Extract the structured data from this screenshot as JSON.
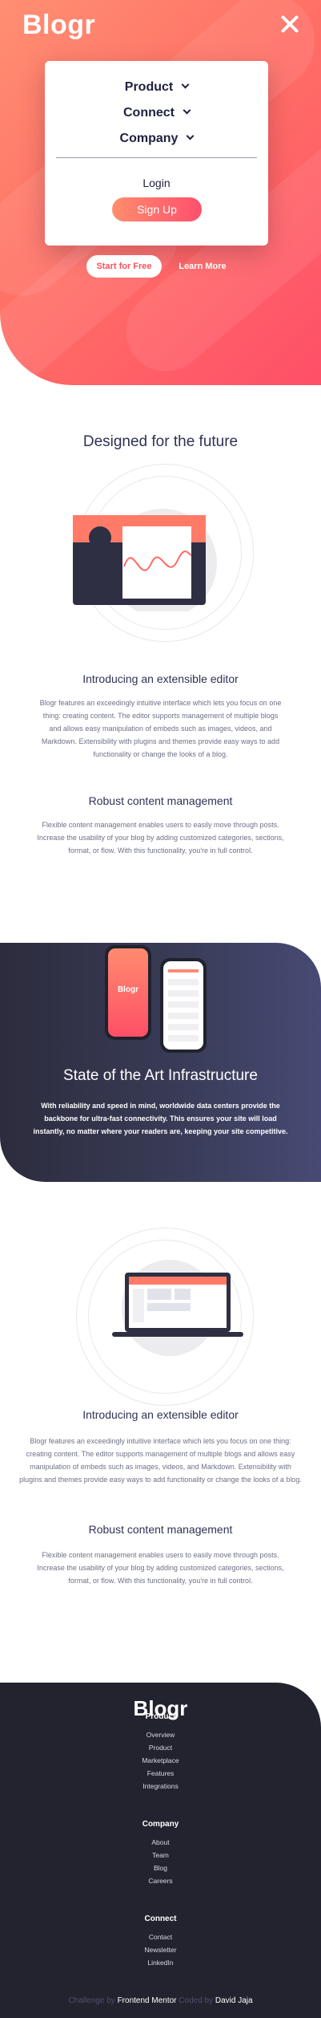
{
  "header": {
    "logo": "Blogr",
    "menu": {
      "items": [
        {
          "label": "Product"
        },
        {
          "label": "Connect"
        },
        {
          "label": "Company"
        }
      ],
      "login_label": "Login",
      "signup_label": "Sign Up"
    },
    "cta": {
      "start_label": "Start for Free",
      "learn_label": "Learn More"
    }
  },
  "future": {
    "title": "Designed for the future",
    "editor_title": "Introducing an extensible editor",
    "editor_text": "Blogr features an exceedingly intuitive interface which lets you focus on one thing: creating content. The editor supports management of multiple blogs and allows easy manipulation of embeds such as images, videos, and Markdown. Extensibility with plugins and themes provide easy ways to add functionality or change the looks of a blog.",
    "content_title": "Robust content management",
    "content_text": "Flexible content management enables users to easily move through posts. Increase the usability of your blog by adding customized categories, sections, format, or flow. With this functionality, you're in full control."
  },
  "infrastructure": {
    "phone_logo": "Blogr",
    "title": "State of the Art Infrastructure",
    "text": "With reliability and speed in mind, worldwide data centers provide the backbone for ultra-fast connectivity. This ensures your site will load instantly, no matter where your readers are, keeping your site competitive."
  },
  "features": {
    "editor_title": "Introducing an extensible editor",
    "editor_text": "Blogr features an exceedingly intuitive interface which lets you focus on one thing: creating content. The editor supports management of multiple blogs and allows easy manipulation of embeds such as images, videos, and Markdown. Extensibility with plugins and themes provide easy ways to add functionality or change the looks of a blog.",
    "content_title": "Robust content management",
    "content_text": "Flexible content management enables users to easily move through posts. Increase the usability of your blog by adding customized categories, sections, format, or flow. With this functionality, you're in full control."
  },
  "footer": {
    "logo": "Blogr",
    "columns": [
      {
        "heading": "Product",
        "links": [
          "Overview",
          "Product",
          "Marketplace",
          "Features",
          "Integrations"
        ]
      },
      {
        "heading": "Company",
        "links": [
          "About",
          "Team",
          "Blog",
          "Careers"
        ]
      },
      {
        "heading": "Connect",
        "links": [
          "Contact",
          "Newsletter",
          "LinkedIn"
        ]
      }
    ],
    "attribution": {
      "challenge_by": "Challenge by",
      "fm_name": "Frontend Mentor",
      "coded_by": "Coded by",
      "author": "David Jaja"
    }
  },
  "colors": {
    "hero_start": "#ff8f72",
    "hero_end": "#ff4f68",
    "heading": "#2f3255",
    "dark_bg": "#2c2c3d",
    "footer_bg": "#232330"
  }
}
